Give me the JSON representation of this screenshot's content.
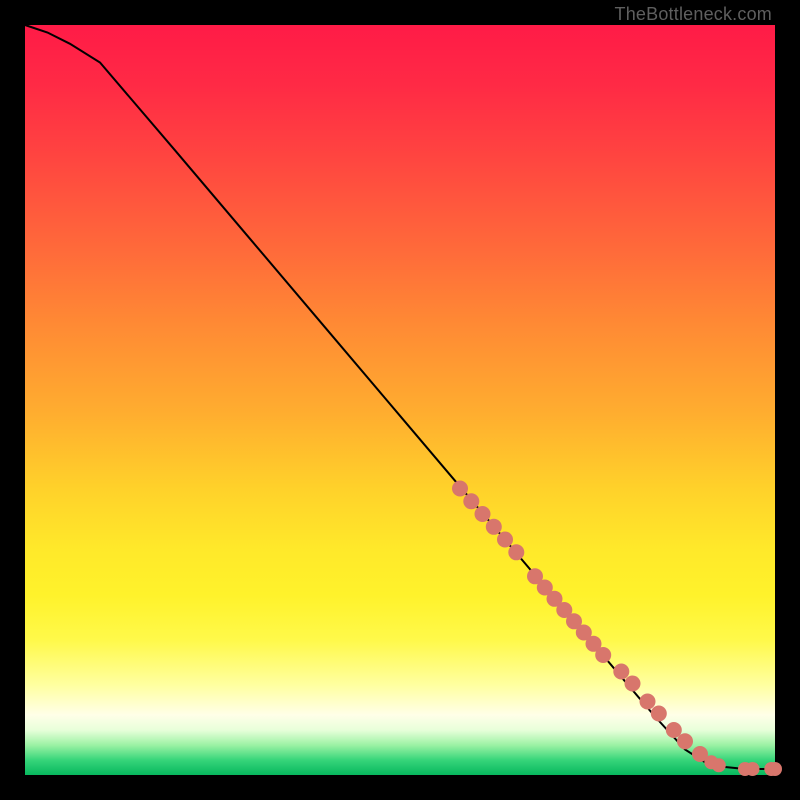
{
  "attribution": "TheBottleneck.com",
  "colors": {
    "point_fill": "#d8766c",
    "curve_stroke": "#000000"
  },
  "chart_data": {
    "type": "line",
    "title": "",
    "xlabel": "",
    "ylabel": "",
    "xlim": [
      0,
      100
    ],
    "ylim": [
      0,
      100
    ],
    "grid": false,
    "legend": false,
    "series": [
      {
        "name": "curve",
        "kind": "line",
        "x": [
          0,
          3,
          6,
          10,
          20,
          30,
          40,
          50,
          60,
          70,
          75,
          80,
          84,
          88,
          91,
          93,
          95,
          97,
          99,
          100
        ],
        "y": [
          100,
          99,
          97.5,
          95,
          83.3,
          71.5,
          59.7,
          47.9,
          36.1,
          24.3,
          18.4,
          12.5,
          7.8,
          3.4,
          1.5,
          1.1,
          0.9,
          0.8,
          0.8,
          0.8
        ]
      },
      {
        "name": "points",
        "kind": "scatter",
        "x": [
          58,
          59.5,
          61,
          62.5,
          64,
          65.5,
          68,
          69.3,
          70.6,
          71.9,
          73.2,
          74.5,
          75.8,
          77.1,
          79.5,
          81,
          83,
          84.5,
          86.5,
          88,
          90,
          91.5,
          92.5,
          96,
          97,
          99.5,
          100
        ],
        "y": [
          38.2,
          36.5,
          34.8,
          33.1,
          31.4,
          29.7,
          26.5,
          25.0,
          23.5,
          22.0,
          20.5,
          19.0,
          17.5,
          16.0,
          13.8,
          12.2,
          9.8,
          8.2,
          6.0,
          4.5,
          2.8,
          1.7,
          1.3,
          0.8,
          0.8,
          0.8,
          0.8
        ],
        "r": [
          8,
          8,
          8,
          8,
          8,
          8,
          8,
          8,
          8,
          8,
          8,
          8,
          8,
          8,
          8,
          8,
          8,
          8,
          8,
          8,
          8,
          7,
          7,
          7,
          7,
          7,
          7
        ]
      }
    ]
  }
}
